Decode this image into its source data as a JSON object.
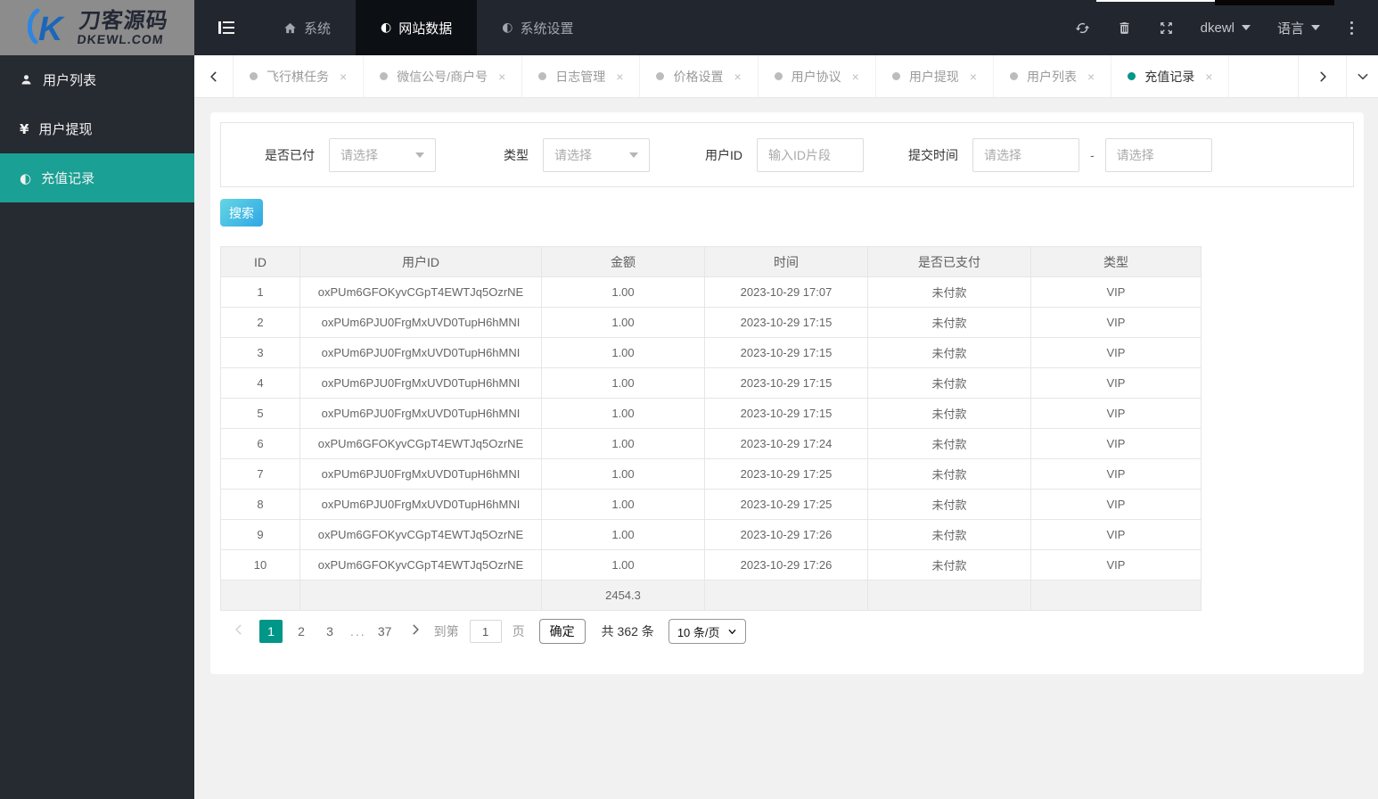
{
  "brand": {
    "name": "刀客源码",
    "domain": "DKEWL.COM",
    "mark": "K"
  },
  "icons": {
    "half_circle_glyph": "◐",
    "yen_glyph": "¥",
    "close_glyph": "×"
  },
  "header": {
    "menu": [
      {
        "label": "系统"
      },
      {
        "label": "网站数据",
        "active": true
      },
      {
        "label": "系统设置"
      }
    ],
    "user": "dkewl",
    "language": "语言"
  },
  "tabs": {
    "items": [
      {
        "label": "飞行棋任务"
      },
      {
        "label": "微信公号/商户号"
      },
      {
        "label": "日志管理"
      },
      {
        "label": "价格设置"
      },
      {
        "label": "用户协议"
      },
      {
        "label": "用户提现"
      },
      {
        "label": "用户列表"
      },
      {
        "label": "充值记录",
        "active": true
      }
    ]
  },
  "sidebar": {
    "items": [
      {
        "label": "用户列表"
      },
      {
        "label": "用户提现"
      },
      {
        "label": "充值记录",
        "active": true
      }
    ]
  },
  "filters": {
    "paid_label": "是否已付",
    "paid_placeholder": "请选择",
    "type_label": "类型",
    "type_placeholder": "请选择",
    "userid_label": "用户ID",
    "userid_placeholder": "输入ID片段",
    "time_label": "提交时间",
    "time_from_placeholder": "请选择",
    "time_to_placeholder": "请选择",
    "time_separator": "-"
  },
  "search_button": "搜索",
  "table": {
    "columns": [
      "ID",
      "用户ID",
      "金额",
      "时间",
      "是否已支付",
      "类型"
    ],
    "rows": [
      [
        "1",
        "oxPUm6GFOKyvCGpT4EWTJq5OzrNE",
        "1.00",
        "2023-10-29 17:07",
        "未付款",
        "VIP"
      ],
      [
        "2",
        "oxPUm6PJU0FrgMxUVD0TupH6hMNI",
        "1.00",
        "2023-10-29 17:15",
        "未付款",
        "VIP"
      ],
      [
        "3",
        "oxPUm6PJU0FrgMxUVD0TupH6hMNI",
        "1.00",
        "2023-10-29 17:15",
        "未付款",
        "VIP"
      ],
      [
        "4",
        "oxPUm6PJU0FrgMxUVD0TupH6hMNI",
        "1.00",
        "2023-10-29 17:15",
        "未付款",
        "VIP"
      ],
      [
        "5",
        "oxPUm6PJU0FrgMxUVD0TupH6hMNI",
        "1.00",
        "2023-10-29 17:15",
        "未付款",
        "VIP"
      ],
      [
        "6",
        "oxPUm6GFOKyvCGpT4EWTJq5OzrNE",
        "1.00",
        "2023-10-29 17:24",
        "未付款",
        "VIP"
      ],
      [
        "7",
        "oxPUm6PJU0FrgMxUVD0TupH6hMNI",
        "1.00",
        "2023-10-29 17:25",
        "未付款",
        "VIP"
      ],
      [
        "8",
        "oxPUm6PJU0FrgMxUVD0TupH6hMNI",
        "1.00",
        "2023-10-29 17:25",
        "未付款",
        "VIP"
      ],
      [
        "9",
        "oxPUm6GFOKyvCGpT4EWTJq5OzrNE",
        "1.00",
        "2023-10-29 17:26",
        "未付款",
        "VIP"
      ],
      [
        "10",
        "oxPUm6GFOKyvCGpT4EWTJq5OzrNE",
        "1.00",
        "2023-10-29 17:26",
        "未付款",
        "VIP"
      ]
    ],
    "summary_amount": "2454.3"
  },
  "pagination": {
    "pages": [
      "1",
      "2",
      "3",
      "...",
      "37"
    ],
    "goto_label": "到第",
    "goto_value": "1",
    "page_unit": "页",
    "confirm_label": "确定",
    "total_label": "共 362 条",
    "page_size": "10 条/页"
  },
  "colors": {
    "accent_teal": "#009688",
    "sidebar_active": "#1aa094",
    "header_bg": "#22262e",
    "search_gradient": [
      "#64d6e3",
      "#2fa7e5"
    ]
  }
}
